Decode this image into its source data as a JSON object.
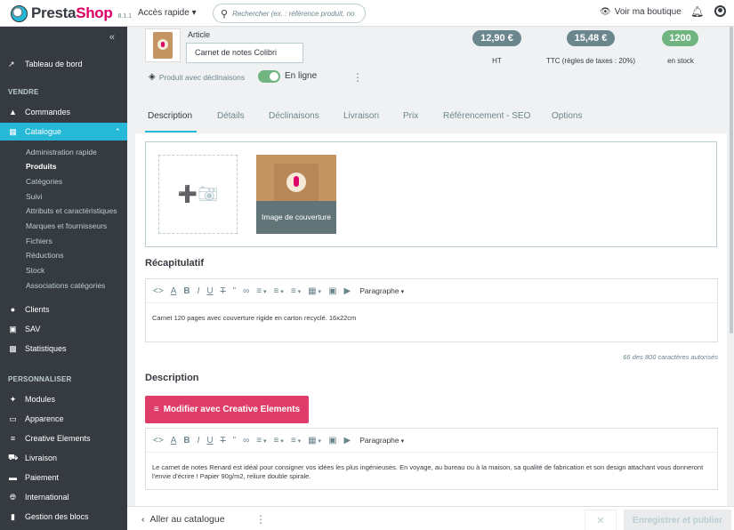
{
  "header": {
    "logo_text_a": "Presta",
    "logo_text_b": "Shop",
    "version": "8.1.1",
    "quick_access": "Accès rapide ▾",
    "search_placeholder": "Rechercher (ex. : référence produit, no",
    "view_shop": "Voir ma boutique"
  },
  "sidebar": {
    "dashboard": "Tableau de bord",
    "sell_title": "VENDRE",
    "orders": "Commandes",
    "catalog": "Catalogue",
    "catalog_sub": [
      "Administration rapide",
      "Produits",
      "Catégories",
      "Suivi",
      "Attributs et caractéristiques",
      "Marques et fournisseurs",
      "Fichiers",
      "Réductions",
      "Stock",
      "Associations catégories"
    ],
    "clients": "Clients",
    "sav": "SAV",
    "stats": "Statistiques",
    "customize_title": "PERSONNALISER",
    "modules": "Modules",
    "appearance": "Apparence",
    "creative": "Creative Elements",
    "shipping": "Livraison",
    "payment": "Paiement",
    "international": "International",
    "blocks": "Gestion des blocs"
  },
  "product": {
    "article_label": "Article",
    "name": "Carnet de notes Colibri",
    "variants": "Produit avec déclinaisons",
    "status": "En ligne",
    "price_ht": "12,90 €",
    "price_ht_caption": "HT",
    "price_ttc": "15,48 €",
    "price_ttc_caption": "TTC (règles de taxes : 20%)",
    "stock": "1200",
    "stock_caption": "en stock"
  },
  "tabs": [
    "Description",
    "Détails",
    "Déclinaisons",
    "Livraison",
    "Prix",
    "Référencement - SEO",
    "Options"
  ],
  "images": {
    "cover_label": "Image de couverture"
  },
  "summary": {
    "title": "Récapitulatif",
    "paragraph_label": "Paragraphe",
    "text": "Carnet 120 pages avec couverture rigide en carton recyclé. 16x22cm",
    "counter": "66 des 800 caractères autorisés"
  },
  "description": {
    "title": "Description",
    "ce_button": "Modifier avec Creative Elements",
    "paragraph_label": "Paragraphe",
    "text": "Le carnet de notes Renard est idéal pour consigner vos idées les plus ingénieuses. En voyage, au bureau ou à la maison, sa qualité de fabrication et son design attachant vous donneront l'envie d'écrire ! Papier 90g/m2, reliure double spirale."
  },
  "footer": {
    "back": "Aller au catalogue",
    "save": "Enregistrer et publier"
  },
  "colors": {
    "accent": "#25b9d7",
    "brand": "#df0067",
    "success": "#70b580",
    "sidebar_bg": "#363a41",
    "ce_button": "#df3c69"
  }
}
